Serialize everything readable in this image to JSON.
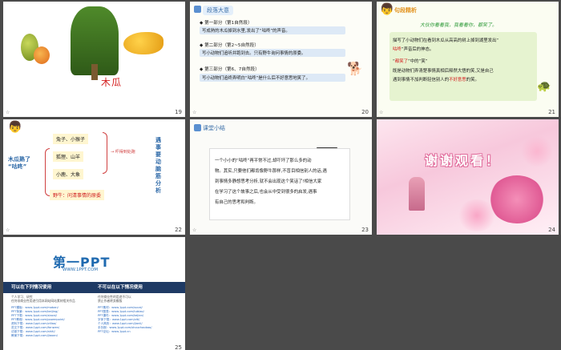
{
  "slides": [
    {
      "number": "19",
      "title": "木瓜"
    },
    {
      "number": "20",
      "header": "段落大意",
      "parts": [
        {
          "label": "◆ 第一部分（第1自然段）",
          "desc": "写成熟的木瓜掉到水里,发出了“咕咚”的声音。"
        },
        {
          "label": "◆ 第二部分（第2~5自然段）",
          "desc": "写小动物们追听并跑到去。只有野牛询问事情的原委。"
        },
        {
          "label": "◆ 第三部分（第6、7自然段）",
          "desc": "写小动物们追终弄明白“咕咚”是什么后不好意思地笑了。"
        }
      ]
    },
    {
      "number": "21",
      "header": "句段精析",
      "quote": "大伙你看看我，我看看你，都笑了。",
      "lines": [
        {
          "pre": "描写了小动物们在看到木瓜从高高的树上掉到湖里发出“",
          "red": "",
          "post": ""
        },
        {
          "pre": "",
          "red": "咕咚",
          "post": "”声音后的神态。"
        },
        {
          "pre": "“",
          "red": "都笑了",
          "post": "”中的“笑”"
        },
        {
          "pre": "既是动物们弄清楚事情真相后释然大悟的笑,又是自己",
          "red": "",
          "post": ""
        },
        {
          "pre": "遇到事情不加判断轻信别人的",
          "red": "不好意思",
          "post": "的笑。"
        }
      ]
    },
    {
      "number": "22",
      "root": "木瓜熟了",
      "root_sub": "“咕咚”",
      "items": [
        "兔子、小猴子",
        "狐狸、山羊",
        "小鹿、大象"
      ],
      "arrow": "→ 吓得到处跑",
      "yeniu": "野牛：问清事情的原委",
      "side": "遇事要动脑筋分析"
    },
    {
      "number": "23",
      "header": "课堂小结",
      "lines": [
        "一个小小的“咕咚”再平常不过,却吓坏了那么多的动",
        "物。其实,只要他们都肯像野牛那样,不盲目相信别人的话,遇",
        "到事情多静想思考分析,就不会出现这个笑话了!相信大家",
        "在学习了这个故事之后,也会从中受到很多的启发,遇事",
        "有自己的思考和判断。"
      ]
    },
    {
      "number": "24",
      "banner": "谢谢观看！"
    },
    {
      "number": "25",
      "logo": "第一PPT",
      "url": "WWW.1PPT.COM",
      "left_head": "可以在下列情况使用",
      "right_head": "不可以在以下情况使用",
      "left_sub": [
        "个人学习、研究",
        "任何非商业性用途引用本网站网站素材相关作品"
      ],
      "right_sub": [
        "任何商业性的用途不可以",
        "禁止作者转卖模版"
      ],
      "left_links": [
        "PPT模板：www.1ppt.com/moban/",
        "PPT背景：www.1ppt.com/beijing/",
        "PPT下载：www.1ppt.com/xiazai/",
        "PPT教程：www.1ppt.com/powerpoint/",
        "资料下载：www.1ppt.com/ziliao/",
        "范文下载：www.1ppt.com/fanwen/",
        "试卷下载：www.1ppt.com/shiti/",
        "教案下载：www.1ppt.com/jiaoan/"
      ],
      "right_links": [
        "PPT素材：www.1ppt.com/sucai/",
        "PPT图表：www.1ppt.com/tubiao/",
        "PPT课件：www.1ppt.com/kejian/",
        "字体下载：www.1ppt.com/ziti/",
        "个人简历：www.1ppt.com/jianli/",
        "手抄报：www.1ppt.com/shouchaobao/",
        "PPT论坛：www.1ppt.cn"
      ]
    }
  ],
  "colors": {
    "background": "#4a4a4a",
    "accent_blue": "#1f6ab0",
    "accent_red": "#d42020"
  }
}
